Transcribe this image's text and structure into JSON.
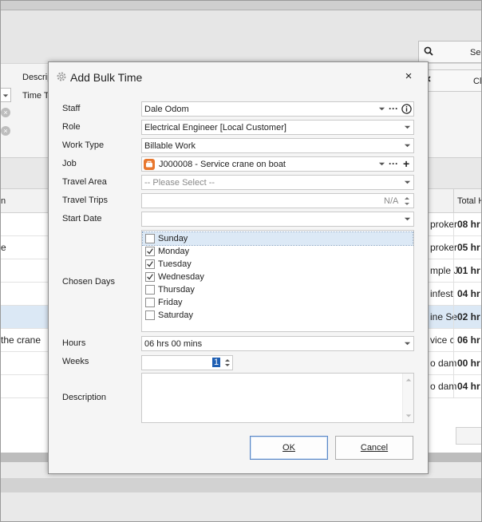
{
  "background": {
    "search_label": "Sea",
    "clear_label": "Cl",
    "filter_labels": {
      "description": "Descrip",
      "time_type": "Time Ty"
    },
    "grid_header_left": "n",
    "grid_header_right": "Total H",
    "rows": [
      {
        "left": "",
        "mid": "proker",
        "right": "08 hr"
      },
      {
        "left": "e",
        "mid": "proker",
        "right": "05 hr"
      },
      {
        "left": "",
        "mid": "mple J",
        "right": "01 hr"
      },
      {
        "left": "",
        "mid": "infest",
        "right": "04 hr"
      },
      {
        "left": "",
        "mid": "ine Se",
        "right": "02 hr",
        "selected": true
      },
      {
        "left": "the crane",
        "mid": "vice c",
        "right": "06 hr"
      },
      {
        "left": "",
        "mid": "o dam",
        "right": "00 hr"
      },
      {
        "left": "",
        "mid": "o dam",
        "right": "04 hr"
      }
    ]
  },
  "dialog": {
    "title": "Add Bulk Time",
    "close_label": "×",
    "fields": {
      "staff": {
        "label": "Staff",
        "value": "Dale Odom"
      },
      "role": {
        "label": "Role",
        "value": "Electrical Engineer [Local Customer]"
      },
      "work_type": {
        "label": "Work Type",
        "value": "Billable Work"
      },
      "job": {
        "label": "Job",
        "value": "J000008 - Service crane on boat"
      },
      "travel_area": {
        "label": "Travel Area",
        "placeholder": "-- Please Select --"
      },
      "travel_trips": {
        "label": "Travel Trips",
        "value": "N/A"
      },
      "start_date": {
        "label": "Start Date",
        "value": ""
      },
      "chosen_days": {
        "label": "Chosen Days"
      },
      "hours": {
        "label": "Hours",
        "value": "06 hrs 00 mins"
      },
      "weeks": {
        "label": "Weeks",
        "value": "1"
      },
      "description": {
        "label": "Description",
        "value": ""
      }
    },
    "days": [
      {
        "label": "Sunday",
        "checked": false
      },
      {
        "label": "Monday",
        "checked": true
      },
      {
        "label": "Tuesday",
        "checked": true
      },
      {
        "label": "Wednesday",
        "checked": true
      },
      {
        "label": "Thursday",
        "checked": false
      },
      {
        "label": "Friday",
        "checked": false
      },
      {
        "label": "Saturday",
        "checked": false
      }
    ],
    "buttons": {
      "ok": "OK",
      "cancel": "Cancel"
    },
    "colors": {
      "accent": "#1e5fb3",
      "job_icon": "#e8772e",
      "selection": "#dce9f6"
    }
  }
}
